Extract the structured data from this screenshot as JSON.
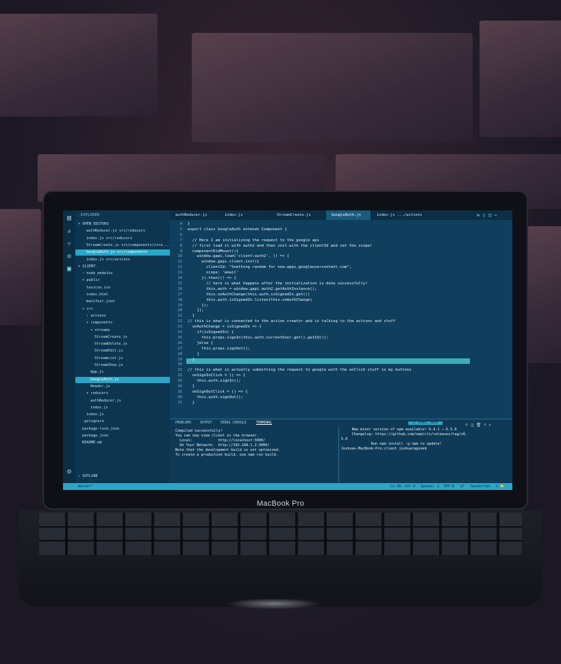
{
  "laptop": {
    "brand": "MacBook Pro"
  },
  "sidebar": {
    "title": "EXPLORER",
    "items": [
      {
        "label": "▾ OPEN EDITORS",
        "depth": 0
      },
      {
        "label": "authReducer.js  src/reducers",
        "depth": 2
      },
      {
        "label": "index.js  src/reducers",
        "depth": 2
      },
      {
        "label": "StreamCreate.js  src/components/stre...",
        "depth": 2
      },
      {
        "label": "GoogleAuth.js  src/components",
        "depth": 2,
        "selected": true,
        "badge": "2"
      },
      {
        "label": "index.js  src/actions",
        "depth": 2
      },
      {
        "label": "▾ CLIENT",
        "depth": 0
      },
      {
        "label": "› node_modules",
        "depth": 1
      },
      {
        "label": "▾ public",
        "depth": 1
      },
      {
        "label": "favicon.ico",
        "depth": 2
      },
      {
        "label": "index.html",
        "depth": 2
      },
      {
        "label": "manifest.json",
        "depth": 2
      },
      {
        "label": "▾ src",
        "depth": 1,
        "dot": "•"
      },
      {
        "label": "› actions",
        "depth": 2
      },
      {
        "label": "▾ components",
        "depth": 2,
        "dot": "•"
      },
      {
        "label": "▾ streams",
        "depth": 3
      },
      {
        "label": "StreamCreate.js",
        "depth": 4
      },
      {
        "label": "StreamDelete.js",
        "depth": 4
      },
      {
        "label": "StreamEdit.js",
        "depth": 4
      },
      {
        "label": "StreamList.js",
        "depth": 4
      },
      {
        "label": "StreamShow.js",
        "depth": 4
      },
      {
        "label": "App.js",
        "depth": 3
      },
      {
        "label": "GoogleAuth.js",
        "depth": 3,
        "selected": true,
        "badge": "2"
      },
      {
        "label": "Header.js",
        "depth": 3
      },
      {
        "label": "▾ reducers",
        "depth": 2
      },
      {
        "label": "authReducer.js",
        "depth": 3
      },
      {
        "label": "index.js",
        "depth": 3
      },
      {
        "label": "index.js",
        "depth": 2
      },
      {
        "label": ".gitignore",
        "depth": 1
      },
      {
        "label": "package-lock.json",
        "depth": 1
      },
      {
        "label": "package.json",
        "depth": 1
      },
      {
        "label": "README.md",
        "depth": 1
      }
    ],
    "outline": "› OUTLINE"
  },
  "tabs": [
    {
      "label": "authReducer.js"
    },
    {
      "label": "index.js  .../reducers"
    },
    {
      "label": "StreamCreate.js"
    },
    {
      "label": "GoogleAuth.js",
      "active": true
    },
    {
      "label": "index.js  .../actions"
    }
  ],
  "editor": {
    "lines": [
      {
        "n": "4",
        "text": "}"
      },
      {
        "n": "5",
        "text": "export class GoogleAuth extends Component {"
      },
      {
        "n": "6",
        "text": ""
      },
      {
        "n": "7",
        "text": "  // Here I am initializing the request to the google api"
      },
      {
        "n": "8",
        "text": "  // first load it with auth2 and then init with the clientId and set the scope!"
      },
      {
        "n": "9",
        "text": "  componentDidMount(){"
      },
      {
        "n": "10",
        "text": "    window.gapi.load('client:auth2', () => {"
      },
      {
        "n": "11",
        "text": "      window.gapi.client.init({"
      },
      {
        "n": "12",
        "text": "        clientId: \"Soething random for now.apps.googleusercontent.com\","
      },
      {
        "n": "13",
        "text": "        scope: 'email'"
      },
      {
        "n": "14",
        "text": "      }).then(() => {"
      },
      {
        "n": "15",
        "text": "        // here is what happens after the initialization is done successfully!"
      },
      {
        "n": "16",
        "text": "        this.auth = window.gapi.auth2.getAuthInstance();"
      },
      {
        "n": "17",
        "text": "        this.onAuthChange(this.auth.isSignedIn.get())"
      },
      {
        "n": "18",
        "text": "        this.auth.isSignedIn.listen(this.onAuthChange)"
      },
      {
        "n": "19",
        "text": "      });"
      },
      {
        "n": "20",
        "text": "    });"
      },
      {
        "n": "21",
        "text": "  }"
      },
      {
        "n": "22",
        "text": "// this is what is connected to the action creator and is talking to the actions and stuff"
      },
      {
        "n": "23",
        "text": "  onAuthChange = isSignedIn => {"
      },
      {
        "n": "24",
        "text": "    if(isSignedIn) {"
      },
      {
        "n": "25",
        "text": "      this.props.signIn(this.auth.currentUser.get().getId());"
      },
      {
        "n": "26",
        "text": "    }else {"
      },
      {
        "n": "27",
        "text": "      this.props.signOut();"
      },
      {
        "n": "28",
        "text": "    }"
      },
      {
        "n": "29",
        "text": "  }"
      },
      {
        "n": "30",
        "text": ""
      },
      {
        "n": "31",
        "text": "// this is what is actually submitting the request to google with the onClick stuff in my buttons"
      },
      {
        "n": "32",
        "text": "  onSignInClick = () => {"
      },
      {
        "n": "33",
        "text": "    this.auth.signIn();"
      },
      {
        "n": "34",
        "text": "  }"
      },
      {
        "n": "35",
        "text": "  onSignOutClick = () => {"
      },
      {
        "n": "36",
        "text": "    this.auth.signOut();"
      },
      {
        "n": "37",
        "text": "  }"
      }
    ]
  },
  "panel": {
    "tabs": [
      "PROBLEMS",
      "OUTPUT",
      "DEBUG CONSOLE",
      "TERMINAL"
    ],
    "active_tab": "TERMINAL",
    "shell_select": "1: node, bash",
    "left_terminal": [
      "Compiled successfully!",
      "",
      "You can now view client in the browser.",
      "",
      "  Local:            http://localhost:3000/",
      "  On Your Network:  http://192.168.1.2:3000/",
      "",
      "Note that the development build is not optimized.",
      "To create a production build, use npm run build."
    ],
    "right_terminal": [
      "     New minor version of npm available! 6.4.1 → 6.5.0",
      "     Changelog: https://github.com/npm/cli/releases/tag/v6.",
      "5.0",
      "              Run npm install -g npm to update!",
      "",
      "",
      "",
      "Joshuas-MacBook-Pro:client joshuaragone$ "
    ]
  },
  "status": {
    "branch": "master*",
    "position": "Ln 29, Col 4",
    "spaces": "Spaces: 2",
    "encoding": "UTF-8",
    "eol": "LF",
    "language": "JavaScript"
  },
  "colors": {
    "screen_bg": "#103f5e",
    "accent": "#2aa6c8",
    "highlight": "#43c3c9"
  }
}
